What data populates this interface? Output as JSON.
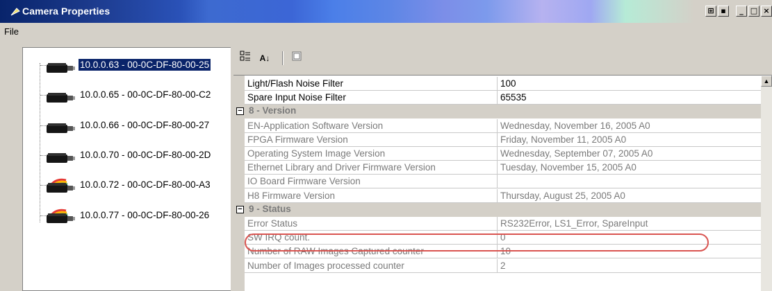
{
  "window": {
    "title": "Camera Properties",
    "buttons": [
      "restore-icon",
      "minimize-icon",
      "maximize-icon",
      "close-icon"
    ]
  },
  "menu": {
    "file": "File"
  },
  "tree": {
    "items": [
      {
        "label": "10.0.0.63 - 00-0C-DF-80-00-25",
        "selected": true,
        "icon": "camera-icon"
      },
      {
        "label": "10.0.0.65 - 00-0C-DF-80-00-C2",
        "selected": false,
        "icon": "camera-icon"
      },
      {
        "label": "10.0.0.66 - 00-0C-DF-80-00-27",
        "selected": false,
        "icon": "camera-icon"
      },
      {
        "label": "10.0.0.70 - 00-0C-DF-80-00-2D",
        "selected": false,
        "icon": "camera-icon"
      },
      {
        "label": "10.0.0.72 - 00-0C-DF-80-00-A3",
        "selected": false,
        "icon": "rainbow-camera-icon"
      },
      {
        "label": "10.0.0.77 - 00-0C-DF-80-00-26",
        "selected": false,
        "icon": "rainbow-camera-icon"
      }
    ]
  },
  "toolbar": {
    "categorized": "categorized-icon",
    "alphabetical": "sort-az-icon",
    "pages": "property-pages-icon"
  },
  "grid": {
    "rows": [
      {
        "kind": "prop",
        "name": "Light/Flash Noise Filter",
        "value": "100",
        "readonly": false
      },
      {
        "kind": "prop",
        "name": "Spare Input Noise Filter",
        "value": "65535",
        "readonly": false
      },
      {
        "kind": "cat",
        "name": "8 - Version"
      },
      {
        "kind": "prop",
        "name": "EN-Application Software Version",
        "value": "Wednesday, November 16, 2005 A0",
        "readonly": true
      },
      {
        "kind": "prop",
        "name": "FPGA Firmware Version",
        "value": "Friday, November 11, 2005 A0",
        "readonly": true
      },
      {
        "kind": "prop",
        "name": "Operating System Image Version",
        "value": "Wednesday, September 07, 2005 A0",
        "readonly": true
      },
      {
        "kind": "prop",
        "name": "Ethernet Library  and Driver Firmware Version",
        "value": "Tuesday, November 15, 2005 A0",
        "readonly": true
      },
      {
        "kind": "prop",
        "name": "IO Board Firmware Version",
        "value": "",
        "readonly": true
      },
      {
        "kind": "prop",
        "name": "H8 Firmware Version",
        "value": "Thursday, August 25, 2005 A0",
        "readonly": true
      },
      {
        "kind": "cat",
        "name": "9 - Status"
      },
      {
        "kind": "prop",
        "name": "Error Status",
        "value": "RS232Error, LS1_Error, SpareInput",
        "readonly": true
      },
      {
        "kind": "prop",
        "name": "SW IRQ count.",
        "value": "0",
        "readonly": true
      },
      {
        "kind": "prop",
        "name": "Number of RAW Images Captured counter",
        "value": "10",
        "readonly": true
      },
      {
        "kind": "prop",
        "name": "Number of Images processed counter",
        "value": "2",
        "readonly": true
      }
    ]
  },
  "colors": {
    "highlight_oval": "#d9534f",
    "selection": "#0a246a"
  }
}
